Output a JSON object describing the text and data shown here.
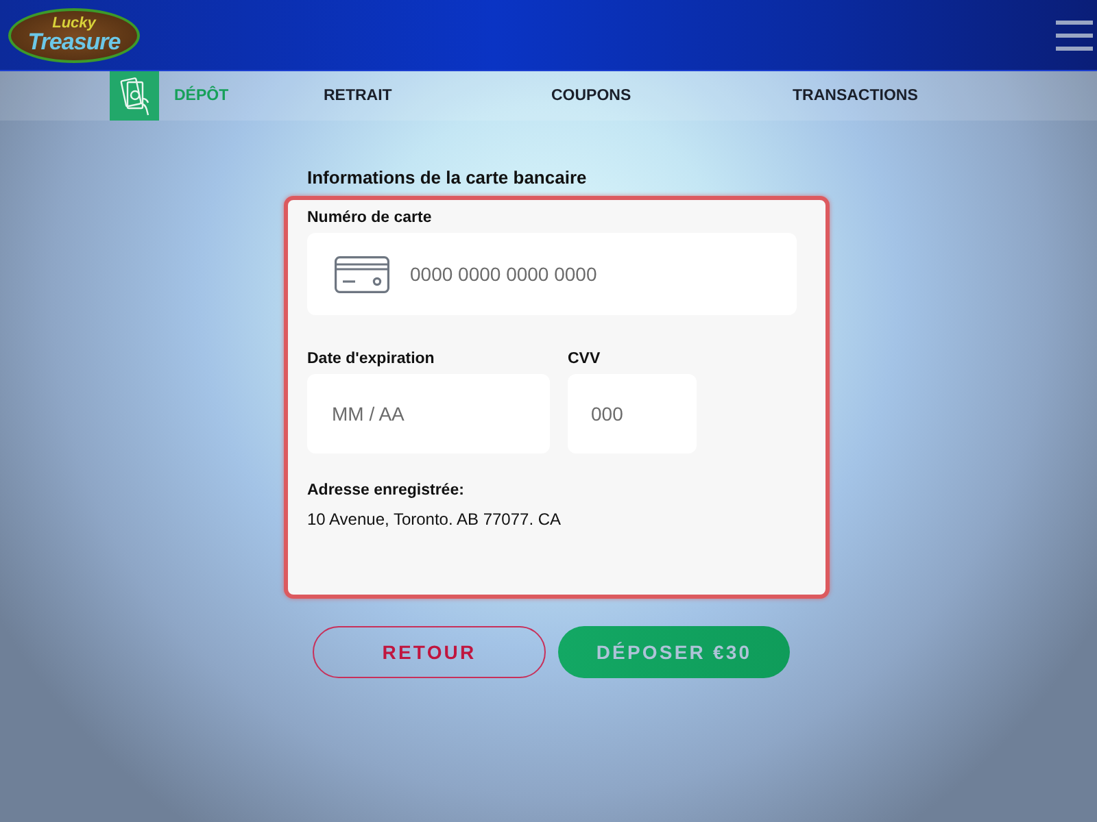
{
  "header": {
    "logo": {
      "line_1": "Lucky",
      "line_2": "Treasure"
    }
  },
  "tabs": [
    {
      "label": "DÉPÔT",
      "selected": true
    },
    {
      "label": "RETRAIT",
      "selected": false
    },
    {
      "label": "COUPONS",
      "selected": false
    },
    {
      "label": "TRANSACTIONS",
      "selected": false
    }
  ],
  "card_form": {
    "title": "Informations de la carte bancaire",
    "fields": [
      {
        "kind": "card",
        "label": "Numéro de carte",
        "placeholder": "0000 0000 0000 0000"
      },
      {
        "kind": "expiry",
        "label": "Date d'expiration",
        "placeholder": "MM / AA"
      },
      {
        "kind": "cvv",
        "label": "CVV",
        "placeholder": "000"
      }
    ],
    "address": {
      "label": "Adresse enregistrée:",
      "value": "10 Avenue, Toronto. AB 77077. CA"
    }
  },
  "buttons": [
    {
      "kind": "outline",
      "label": "RETOUR"
    },
    {
      "kind": "primary",
      "label": "DÉPOSER €30"
    }
  ]
}
